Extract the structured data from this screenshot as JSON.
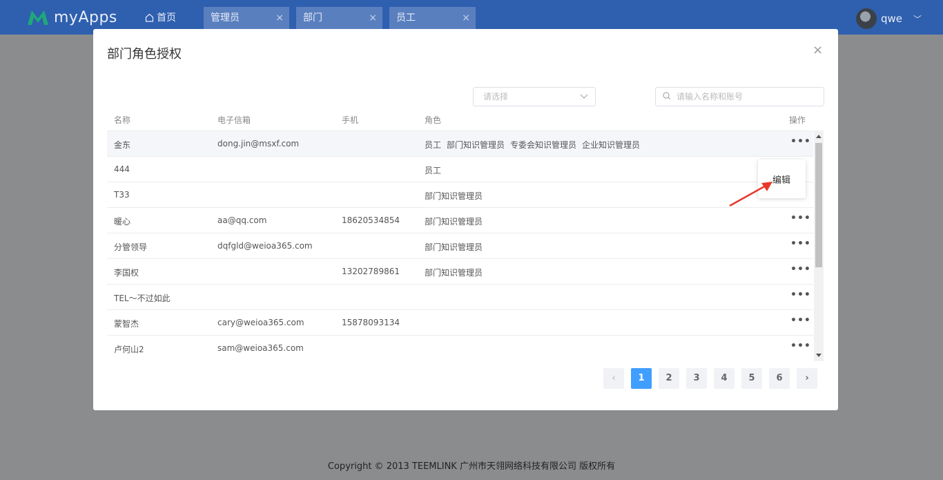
{
  "header": {
    "logo_text": "myApps",
    "home_label": "首页",
    "tabs": [
      {
        "label": "管理员",
        "close": "×"
      },
      {
        "label": "部门",
        "close": "×"
      },
      {
        "label": "员工",
        "close": "×"
      }
    ],
    "user_name": "qwe",
    "user_menu_chevron": "﹀"
  },
  "modal": {
    "title": "部门角色授权",
    "close": "×",
    "filter_select_placeholder": "请选择",
    "search_placeholder": "请输入名称和账号",
    "columns": [
      "名称",
      "电子信箱",
      "手机",
      "角色",
      "操作"
    ],
    "rows": [
      {
        "name": "金东",
        "email": "dong.jin@msxf.com",
        "phone": "",
        "roles": [
          "员工",
          "部门知识管理员",
          "专委会知识管理员",
          "企业知识管理员"
        ],
        "action": "•••"
      },
      {
        "name": "444",
        "email": "",
        "phone": "",
        "roles": [
          "员工"
        ],
        "action": ""
      },
      {
        "name": "T33",
        "email": "",
        "phone": "",
        "roles": [
          "部门知识管理员"
        ],
        "action": ""
      },
      {
        "name": "暖心",
        "email": "aa@qq.com",
        "phone": "18620534854",
        "roles": [
          "部门知识管理员"
        ],
        "action": "•••"
      },
      {
        "name": "分管领导",
        "email": "dqfgld@weioa365.com",
        "phone": "",
        "roles": [
          "部门知识管理员"
        ],
        "action": "•••"
      },
      {
        "name": "李国权",
        "email": "",
        "phone": "13202789861",
        "roles": [
          "部门知识管理员"
        ],
        "action": "•••"
      },
      {
        "name": "TEL～不过如此",
        "email": "",
        "phone": "",
        "roles": [],
        "action": "•••"
      },
      {
        "name": "蒙智杰",
        "email": "cary@weioa365.com",
        "phone": "15878093134",
        "roles": [],
        "action": "•••"
      },
      {
        "name": "卢何山2",
        "email": "sam@weioa365.com",
        "phone": "",
        "roles": [],
        "action": "•••"
      }
    ],
    "popover_label": "编辑",
    "pagination": {
      "prev": "‹",
      "pages": [
        "1",
        "2",
        "3",
        "4",
        "5",
        "6"
      ],
      "current": "1",
      "next": "›"
    }
  },
  "footer": {
    "copyright": "Copyright © 2013 TEEMLINK 广州市天翎网络科技有限公司 版权所有"
  },
  "colors": {
    "header_bg": "#2f5faf",
    "accent": "#409eff",
    "annotation_arrow": "#e8382b"
  }
}
